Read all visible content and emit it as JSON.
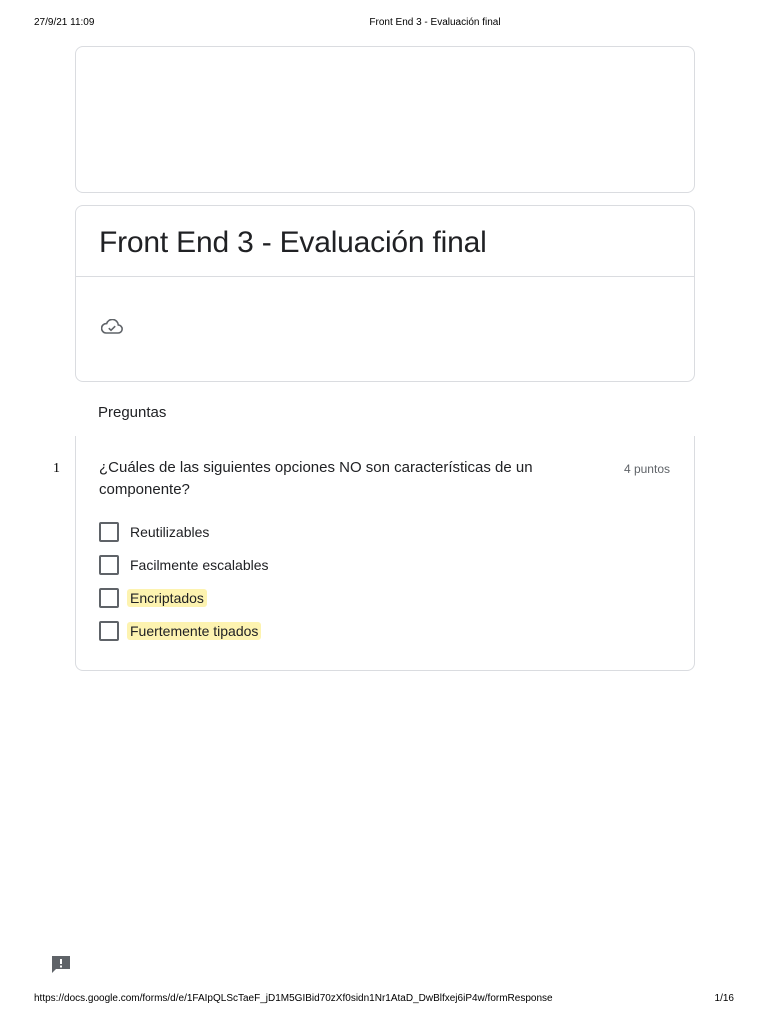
{
  "print_header": {
    "date": "27/9/21 11:09",
    "title": "Front End 3 - Evaluación final"
  },
  "form": {
    "title": "Front End 3 - Evaluación final",
    "status_icon": "cloud-check-icon"
  },
  "section": {
    "label": "Preguntas"
  },
  "question": {
    "number": "1",
    "text": "¿Cuáles de las siguientes opciones NO son características de un componente?",
    "points": "4 puntos",
    "options": [
      {
        "label": "Reutilizables",
        "checked": false,
        "highlighted": false
      },
      {
        "label": "Facilmente escalables",
        "checked": false,
        "highlighted": false
      },
      {
        "label": "Encriptados",
        "checked": false,
        "highlighted": true
      },
      {
        "label": "Fuertemente tipados",
        "checked": false,
        "highlighted": true
      }
    ]
  },
  "feedback": {
    "icon": "report-feedback-icon"
  },
  "print_footer": {
    "url": "https://docs.google.com/forms/d/e/1FAIpQLScTaeF_jD1M5GIBid70zXf0sidn1Nr1AtaD_DwBlfxej6iP4w/formResponse",
    "page": "1/16"
  },
  "colors": {
    "border": "#dadce0",
    "highlight": "#fdf3b0",
    "text": "#202124",
    "muted": "#5f6368"
  }
}
